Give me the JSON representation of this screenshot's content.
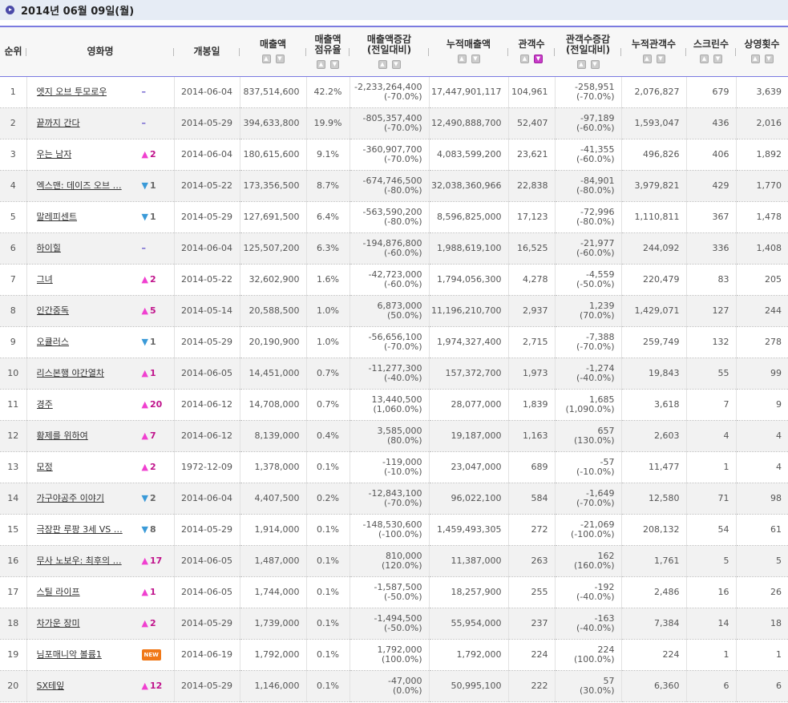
{
  "header": {
    "date_title": "2014년 06월 09일(월)"
  },
  "columns": [
    {
      "l1": "순위",
      "l2": "",
      "sort": false
    },
    {
      "l1": "영화명",
      "l2": "",
      "sort": false
    },
    {
      "l1": "개봉일",
      "l2": "",
      "sort": false
    },
    {
      "l1": "매출액",
      "l2": "",
      "sort": true
    },
    {
      "l1": "매출액",
      "l2": "점유율",
      "sort": true
    },
    {
      "l1": "매출액증감",
      "l2": "(전일대비)",
      "sort": true
    },
    {
      "l1": "누적매출액",
      "l2": "",
      "sort": true
    },
    {
      "l1": "관객수",
      "l2": "",
      "sort": true,
      "active": "down"
    },
    {
      "l1": "관객수증감",
      "l2": "(전일대비)",
      "sort": true
    },
    {
      "l1": "누적관객수",
      "l2": "",
      "sort": true
    },
    {
      "l1": "스크린수",
      "l2": "",
      "sort": true
    },
    {
      "l1": "상영횟수",
      "l2": "",
      "sort": true
    }
  ],
  "rows": [
    {
      "rank": "1",
      "title": "엣지 오브 투모로우",
      "chg": "same",
      "chgv": "–",
      "open": "2014-06-04",
      "sales": "837,514,600",
      "share": "42.2%",
      "sd": "-2,233,264,400",
      "sdp": "(-70.0%)",
      "cum": "17,447,901,117",
      "aud": "104,961",
      "ad": "-258,951",
      "adp": "(-70.0%)",
      "cumaud": "2,076,827",
      "scr": "679",
      "show": "3,639"
    },
    {
      "rank": "2",
      "title": "끝까지 간다",
      "chg": "same",
      "chgv": "–",
      "open": "2014-05-29",
      "sales": "394,633,800",
      "share": "19.9%",
      "sd": "-805,357,400",
      "sdp": "(-70.0%)",
      "cum": "12,490,888,700",
      "aud": "52,407",
      "ad": "-97,189",
      "adp": "(-60.0%)",
      "cumaud": "1,593,047",
      "scr": "436",
      "show": "2,016"
    },
    {
      "rank": "3",
      "title": "우는 남자",
      "chg": "up",
      "chgv": "2",
      "open": "2014-06-04",
      "sales": "180,615,600",
      "share": "9.1%",
      "sd": "-360,907,700",
      "sdp": "(-70.0%)",
      "cum": "4,083,599,200",
      "aud": "23,621",
      "ad": "-41,355",
      "adp": "(-60.0%)",
      "cumaud": "496,826",
      "scr": "406",
      "show": "1,892"
    },
    {
      "rank": "4",
      "title": "엑스맨: 데이즈 오브 …",
      "chg": "down",
      "chgv": "1",
      "open": "2014-05-22",
      "sales": "173,356,500",
      "share": "8.7%",
      "sd": "-674,746,500",
      "sdp": "(-80.0%)",
      "cum": "32,038,360,966",
      "aud": "22,838",
      "ad": "-84,901",
      "adp": "(-80.0%)",
      "cumaud": "3,979,821",
      "scr": "429",
      "show": "1,770"
    },
    {
      "rank": "5",
      "title": "말레피센트",
      "chg": "down",
      "chgv": "1",
      "open": "2014-05-29",
      "sales": "127,691,500",
      "share": "6.4%",
      "sd": "-563,590,200",
      "sdp": "(-80.0%)",
      "cum": "8,596,825,000",
      "aud": "17,123",
      "ad": "-72,996",
      "adp": "(-80.0%)",
      "cumaud": "1,110,811",
      "scr": "367",
      "show": "1,478"
    },
    {
      "rank": "6",
      "title": "하이힐",
      "chg": "same",
      "chgv": "–",
      "open": "2014-06-04",
      "sales": "125,507,200",
      "share": "6.3%",
      "sd": "-194,876,800",
      "sdp": "(-60.0%)",
      "cum": "1,988,619,100",
      "aud": "16,525",
      "ad": "-21,977",
      "adp": "(-60.0%)",
      "cumaud": "244,092",
      "scr": "336",
      "show": "1,408"
    },
    {
      "rank": "7",
      "title": "그녀",
      "chg": "up",
      "chgv": "2",
      "open": "2014-05-22",
      "sales": "32,602,900",
      "share": "1.6%",
      "sd": "-42,723,000",
      "sdp": "(-60.0%)",
      "cum": "1,794,056,300",
      "aud": "4,278",
      "ad": "-4,559",
      "adp": "(-50.0%)",
      "cumaud": "220,479",
      "scr": "83",
      "show": "205"
    },
    {
      "rank": "8",
      "title": "인간중독",
      "chg": "up",
      "chgv": "5",
      "open": "2014-05-14",
      "sales": "20,588,500",
      "share": "1.0%",
      "sd": "6,873,000",
      "sdp": "(50.0%)",
      "cum": "11,196,210,700",
      "aud": "2,937",
      "ad": "1,239",
      "adp": "(70.0%)",
      "cumaud": "1,429,071",
      "scr": "127",
      "show": "244"
    },
    {
      "rank": "9",
      "title": "오큘러스",
      "chg": "down",
      "chgv": "1",
      "open": "2014-05-29",
      "sales": "20,190,900",
      "share": "1.0%",
      "sd": "-56,656,100",
      "sdp": "(-70.0%)",
      "cum": "1,974,327,400",
      "aud": "2,715",
      "ad": "-7,388",
      "adp": "(-70.0%)",
      "cumaud": "259,749",
      "scr": "132",
      "show": "278"
    },
    {
      "rank": "10",
      "title": "리스본행 야간열차",
      "chg": "up",
      "chgv": "1",
      "open": "2014-06-05",
      "sales": "14,451,000",
      "share": "0.7%",
      "sd": "-11,277,300",
      "sdp": "(-40.0%)",
      "cum": "157,372,700",
      "aud": "1,973",
      "ad": "-1,274",
      "adp": "(-40.0%)",
      "cumaud": "19,843",
      "scr": "55",
      "show": "99"
    },
    {
      "rank": "11",
      "title": "경주",
      "chg": "up",
      "chgv": "20",
      "open": "2014-06-12",
      "sales": "14,708,000",
      "share": "0.7%",
      "sd": "13,440,500",
      "sdp": "(1,060.0%)",
      "cum": "28,077,000",
      "aud": "1,839",
      "ad": "1,685",
      "adp": "(1,090.0%)",
      "cumaud": "3,618",
      "scr": "7",
      "show": "9"
    },
    {
      "rank": "12",
      "title": "황제를 위하여",
      "chg": "up",
      "chgv": "7",
      "open": "2014-06-12",
      "sales": "8,139,000",
      "share": "0.4%",
      "sd": "3,585,000",
      "sdp": "(80.0%)",
      "cum": "19,187,000",
      "aud": "1,163",
      "ad": "657",
      "adp": "(130.0%)",
      "cumaud": "2,603",
      "scr": "4",
      "show": "4"
    },
    {
      "rank": "13",
      "title": "모정",
      "chg": "up",
      "chgv": "2",
      "open": "1972-12-09",
      "sales": "1,378,000",
      "share": "0.1%",
      "sd": "-119,000",
      "sdp": "(-10.0%)",
      "cum": "23,047,000",
      "aud": "689",
      "ad": "-57",
      "adp": "(-10.0%)",
      "cumaud": "11,477",
      "scr": "1",
      "show": "4"
    },
    {
      "rank": "14",
      "title": "가구야공주 이야기",
      "chg": "down",
      "chgv": "2",
      "open": "2014-06-04",
      "sales": "4,407,500",
      "share": "0.2%",
      "sd": "-12,843,100",
      "sdp": "(-70.0%)",
      "cum": "96,022,100",
      "aud": "584",
      "ad": "-1,649",
      "adp": "(-70.0%)",
      "cumaud": "12,580",
      "scr": "71",
      "show": "98"
    },
    {
      "rank": "15",
      "title": "극장판 루팡 3세 VS …",
      "chg": "down",
      "chgv": "8",
      "open": "2014-05-29",
      "sales": "1,914,000",
      "share": "0.1%",
      "sd": "-148,530,600",
      "sdp": "(-100.0%)",
      "cum": "1,459,493,305",
      "aud": "272",
      "ad": "-21,069",
      "adp": "(-100.0%)",
      "cumaud": "208,132",
      "scr": "54",
      "show": "61"
    },
    {
      "rank": "16",
      "title": "무사 노보우: 최후의 …",
      "chg": "up",
      "chgv": "17",
      "open": "2014-06-05",
      "sales": "1,487,000",
      "share": "0.1%",
      "sd": "810,000",
      "sdp": "(120.0%)",
      "cum": "11,387,000",
      "aud": "263",
      "ad": "162",
      "adp": "(160.0%)",
      "cumaud": "1,761",
      "scr": "5",
      "show": "5"
    },
    {
      "rank": "17",
      "title": "스틸 라이프",
      "chg": "up",
      "chgv": "1",
      "open": "2014-06-05",
      "sales": "1,744,000",
      "share": "0.1%",
      "sd": "-1,587,500",
      "sdp": "(-50.0%)",
      "cum": "18,257,900",
      "aud": "255",
      "ad": "-192",
      "adp": "(-40.0%)",
      "cumaud": "2,486",
      "scr": "16",
      "show": "26"
    },
    {
      "rank": "18",
      "title": "차가운 장미",
      "chg": "up",
      "chgv": "2",
      "open": "2014-05-29",
      "sales": "1,739,000",
      "share": "0.1%",
      "sd": "-1,494,500",
      "sdp": "(-50.0%)",
      "cum": "55,954,000",
      "aud": "237",
      "ad": "-163",
      "adp": "(-40.0%)",
      "cumaud": "7,384",
      "scr": "14",
      "show": "18"
    },
    {
      "rank": "19",
      "title": "님포매니악 볼륨1",
      "chg": "new",
      "chgv": "NEW",
      "open": "2014-06-19",
      "sales": "1,792,000",
      "share": "0.1%",
      "sd": "1,792,000",
      "sdp": "(100.0%)",
      "cum": "1,792,000",
      "aud": "224",
      "ad": "224",
      "adp": "(100.0%)",
      "cumaud": "224",
      "scr": "1",
      "show": "1"
    },
    {
      "rank": "20",
      "title": "SX테잎",
      "chg": "up",
      "chgv": "12",
      "open": "2014-05-29",
      "sales": "1,146,000",
      "share": "0.1%",
      "sd": "-47,000",
      "sdp": "(0.0%)",
      "cum": "50,995,100",
      "aud": "222",
      "ad": "57",
      "adp": "(30.0%)",
      "cumaud": "6,360",
      "scr": "6",
      "show": "6"
    }
  ]
}
